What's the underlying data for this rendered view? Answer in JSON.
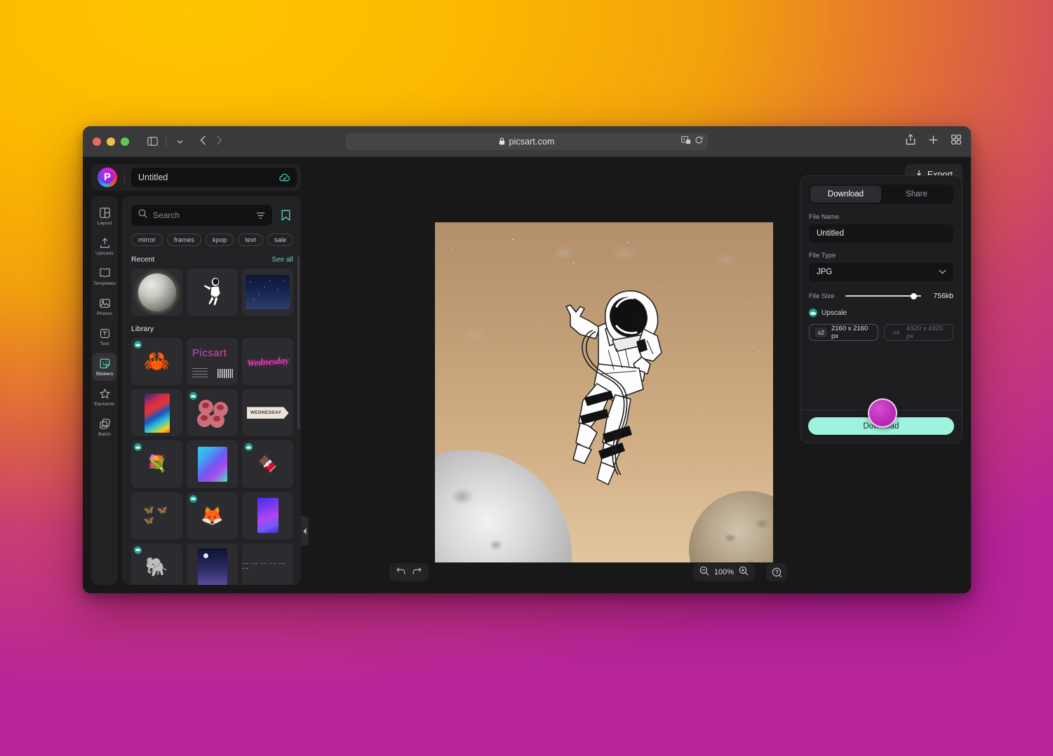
{
  "browser": {
    "url": "picsart.com",
    "lock_icon": "lock-icon",
    "shield_icon": "shield-icon",
    "sidebar_toggle_icon": "sidebar-toggle-icon",
    "tab_overview_chevron": "chevron-down-icon",
    "back_icon": "back-chevron-icon",
    "forward_icon": "forward-chevron-icon",
    "reader_icon": "reader-mode-icon",
    "reload_icon": "reload-icon",
    "share_icon": "share-icon",
    "new_tab_icon": "plus-icon",
    "tab_grid_icon": "tab-grid-icon",
    "traffic_lights": [
      "close",
      "minimize",
      "maximize"
    ]
  },
  "app": {
    "logo_letter": "P",
    "document_title": "Untitled",
    "cloud_status_icon": "cloud-check-icon",
    "export_label": "Export",
    "export_icon": "download-icon"
  },
  "sidebar": {
    "items": [
      {
        "label": "Layout",
        "icon": "layout-icon",
        "active": false
      },
      {
        "label": "Uploads",
        "icon": "upload-icon",
        "active": false
      },
      {
        "label": "Templates",
        "icon": "templates-icon",
        "active": false
      },
      {
        "label": "Photos",
        "icon": "photos-icon",
        "active": false
      },
      {
        "label": "Text",
        "icon": "text-icon",
        "active": false
      },
      {
        "label": "Stickers",
        "icon": "stickers-icon",
        "active": true
      },
      {
        "label": "Elements",
        "icon": "star-icon",
        "active": false
      },
      {
        "label": "Batch",
        "icon": "batch-icon",
        "active": false
      }
    ]
  },
  "stickers_panel": {
    "search": {
      "placeholder": "Search",
      "value": "",
      "search_icon": "search-icon",
      "filter_icon": "filter-icon"
    },
    "bookmark_icon": "bookmark-icon",
    "tags": [
      "mirror",
      "frames",
      "kpop",
      "text",
      "sale"
    ],
    "recent": {
      "title": "Recent",
      "see_all": "See all",
      "items": [
        {
          "name": "moon-sticker"
        },
        {
          "name": "astronaut-sticker"
        },
        {
          "name": "night-sky-sticker"
        }
      ]
    },
    "library": {
      "title": "Library",
      "items": [
        {
          "name": "crab-sticker",
          "premium": true
        },
        {
          "name": "picsart-card-sticker",
          "premium": false,
          "word": "Picsart"
        },
        {
          "name": "wednesday-script-sticker",
          "premium": false,
          "word": "Wednesday"
        },
        {
          "name": "gradient-stripes-sticker",
          "premium": false
        },
        {
          "name": "berries-sticker",
          "premium": true
        },
        {
          "name": "wednesday-tag-sticker",
          "premium": false,
          "word": "WEDNESDAY"
        },
        {
          "name": "flower-bouquet-sticker",
          "premium": true
        },
        {
          "name": "aurora-gradient-sticker",
          "premium": false
        },
        {
          "name": "chocolate-sticker",
          "premium": true
        },
        {
          "name": "butterflies-sticker",
          "premium": false
        },
        {
          "name": "fox-detective-sticker",
          "premium": true
        },
        {
          "name": "purple-gradient-sticker",
          "premium": false
        },
        {
          "name": "elephant-sticker",
          "premium": true
        },
        {
          "name": "night-clouds-sticker",
          "premium": false
        },
        {
          "name": "dashes-sticker",
          "premium": false
        }
      ]
    },
    "collapse_icon": "collapse-left-icon"
  },
  "canvas": {
    "artwork_name": "astronaut-in-space-artwork",
    "undo_icon": "undo-icon",
    "redo_icon": "redo-icon",
    "zoom_out_icon": "zoom-out-icon",
    "zoom_in_icon": "zoom-in-icon",
    "zoom_level": "100%",
    "help_icon": "help-chat-icon"
  },
  "download_panel": {
    "tabs": [
      {
        "label": "Download",
        "active": true
      },
      {
        "label": "Share",
        "active": false
      }
    ],
    "file_name_label": "File Name",
    "file_name_value": "Untitled",
    "file_type_label": "File Type",
    "file_type_value": "JPG",
    "file_type_chevron": "chevron-down-icon",
    "file_size_label": "File Size",
    "file_size_value": "756kb",
    "upscale_label": "Upscale",
    "upscale_icon": "upscale-icon",
    "upscale_options": [
      {
        "multiplier": "x2",
        "size": "2160 x 2160 px",
        "selected": true
      },
      {
        "multiplier": "x4",
        "size": "4320 x 4320 px",
        "selected": false
      }
    ],
    "download_button_label": "Download",
    "cursor_name": "mouse-cursor-highlight"
  },
  "colors": {
    "accent_teal": "#56d6c2",
    "download_button": "#9df3de",
    "cursor_magenta": "#bd2cb8",
    "panel_bg": "#222225",
    "app_bg": "#181818",
    "desktop_gradient_start": "#ffc107",
    "desktop_gradient_end": "#b61b9b"
  }
}
